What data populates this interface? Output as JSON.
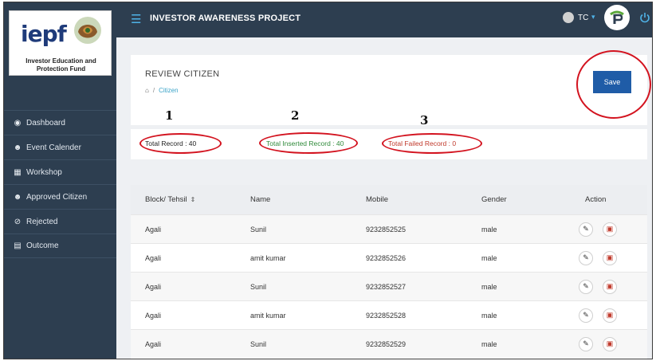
{
  "sidebar": {
    "logo_text": "iepf",
    "logo_caption": "Investor Education and Protection Fund",
    "items": [
      {
        "label": "Dashboard",
        "icon": "dashboard-icon"
      },
      {
        "label": "Event Calender",
        "icon": "users-icon"
      },
      {
        "label": "Workshop",
        "icon": "document-icon"
      },
      {
        "label": "Approved Citizen",
        "icon": "users-icon"
      },
      {
        "label": "Rejected",
        "icon": "ban-icon"
      },
      {
        "label": "Outcome",
        "icon": "list-icon"
      }
    ]
  },
  "topbar": {
    "title": "INVESTOR AWARENESS PROJECT",
    "user": "TC"
  },
  "page": {
    "title": "REVIEW CITIZEN",
    "breadcrumb_current": "Citizen",
    "save_label": "Save"
  },
  "stats": {
    "total": "Total Record : 40",
    "inserted": "Total Inserted Record : 40",
    "failed": "Total Failed Record : 0"
  },
  "annotations": [
    "1",
    "2",
    "3"
  ],
  "table": {
    "headers": [
      "Block/ Tehsil",
      "Name",
      "Mobile",
      "Gender",
      "Action"
    ],
    "rows": [
      [
        "Agali",
        "Sunil",
        "9232852525",
        "male"
      ],
      [
        "Agali",
        "amit kumar",
        "9232852526",
        "male"
      ],
      [
        "Agali",
        "Sunil",
        "9232852527",
        "male"
      ],
      [
        "Agali",
        "amit kumar",
        "9232852528",
        "male"
      ],
      [
        "Agali",
        "Sunil",
        "9232852529",
        "male"
      ]
    ]
  },
  "colors": {
    "sidebar_bg": "#2d3e50",
    "accent": "#4fb3e8",
    "save_button": "#1f5ca7",
    "inserted_text": "#2f8a3a",
    "failed_text": "#c0392b",
    "annotation": "#d3131f"
  }
}
